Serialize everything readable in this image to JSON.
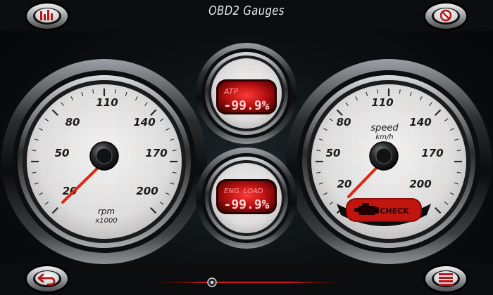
{
  "app": {
    "title": "OBD2 Gauges"
  },
  "toolbar": {
    "top_left_icon": "bar-chart-icon",
    "top_right_icon": "no-entry-icon",
    "bottom_left_icon": "back-arrow-icon",
    "bottom_right_icon": "menu-icon"
  },
  "rpm_gauge": {
    "ticks": [
      "20",
      "50",
      "80",
      "110",
      "140",
      "170",
      "200"
    ],
    "unit_line1": "rpm",
    "unit_line2": "x1000",
    "needle_value": 20
  },
  "speed_gauge": {
    "ticks": [
      "20",
      "50",
      "80",
      "110",
      "140",
      "170",
      "200"
    ],
    "unit_line1": "speed",
    "unit_line2": "km/h",
    "needle_value": 20,
    "check_label": "CHECK"
  },
  "atp_gauge": {
    "label": "ATP",
    "value": "-99.9%"
  },
  "load_gauge": {
    "label": "ENG. LOAD",
    "value": "-99.9%"
  },
  "colors": {
    "accent_red": "#d61a1a",
    "display_red": "#ff4a4a",
    "tick_dark": "#1a1a1a"
  },
  "slider": {
    "position": 0.5
  }
}
